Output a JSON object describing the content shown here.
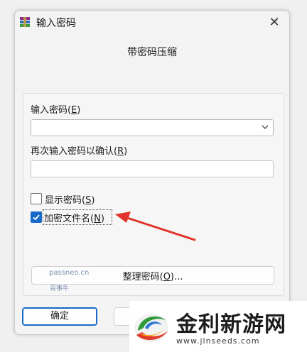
{
  "window": {
    "title": "输入密码",
    "close_glyph": "✕",
    "subtitle": "带密码压缩"
  },
  "password": {
    "label_prefix": "输入密码(",
    "label_mnemonic": "E",
    "label_suffix": ")",
    "value": ""
  },
  "confirm": {
    "label_prefix": "再次输入密码以确认(",
    "label_mnemonic": "R",
    "label_suffix": ")",
    "value": ""
  },
  "show_password": {
    "label_prefix": "显示密码(",
    "label_mnemonic": "S",
    "label_suffix": ")",
    "checked": false
  },
  "encrypt_names": {
    "label_prefix": "加密文件名(",
    "label_mnemonic": "N",
    "label_suffix": ")",
    "checked": true
  },
  "organize_button": {
    "label_prefix": "整理密码(",
    "label_mnemonic": "O",
    "label_suffix": ")..."
  },
  "watermark": {
    "line1": "passneo.cn",
    "line2": "百事牛"
  },
  "footer": {
    "ok_label": "确定"
  },
  "logo": {
    "name": "金利新游网",
    "url": "www.jlnseeds.com"
  },
  "colors": {
    "accent": "#1769c7",
    "arrow": "#e0342a"
  }
}
